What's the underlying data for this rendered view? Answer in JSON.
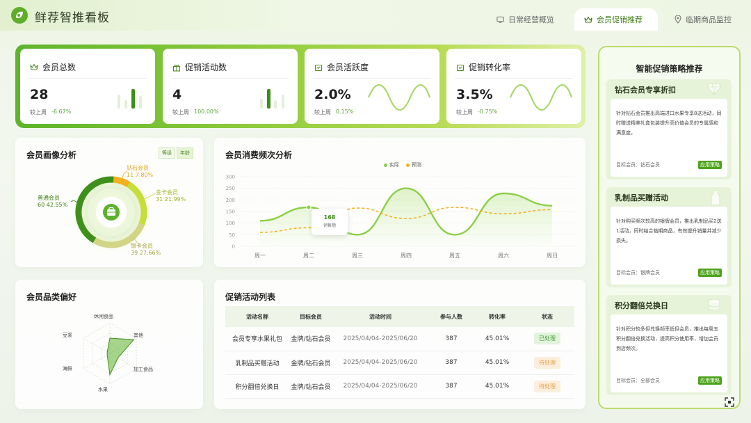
{
  "app": {
    "title": "鲜荐智推看板"
  },
  "tabs": [
    {
      "label": "日常经营概览",
      "active": false
    },
    {
      "label": "会员促销推荐",
      "active": true
    },
    {
      "label": "临期商品监控",
      "active": false
    }
  ],
  "kpis": [
    {
      "title": "会员总数",
      "value": "28",
      "compare_label": "较上周",
      "delta": "-6.67%",
      "icon": "crown-icon"
    },
    {
      "title": "促销活动数",
      "value": "4",
      "compare_label": "较上周",
      "delta": "100.00%",
      "icon": "gift-icon"
    },
    {
      "title": "会员活跃度",
      "value": "2.0%",
      "compare_label": "较上周",
      "delta": "0.15%",
      "icon": "activity-icon"
    },
    {
      "title": "促销转化率",
      "value": "3.5%",
      "compare_label": "较上周",
      "delta": "-0.75%",
      "icon": "conversion-icon"
    }
  ],
  "member_portrait": {
    "title": "会员画像分析",
    "toggle": [
      "等级",
      "年龄"
    ],
    "segments": [
      {
        "name": "钻石会员",
        "count": "11",
        "pct": "7.80%",
        "value": 7.8,
        "color": "#f2b01e"
      },
      {
        "name": "金卡会员",
        "count": "31",
        "pct": "21.99%",
        "value": 21.99,
        "color": "#c7dd3a"
      },
      {
        "name": "银卡会员",
        "count": "39",
        "pct": "27.66%",
        "value": 27.66,
        "color": "#d2d486"
      },
      {
        "name": "普通会员",
        "count": "60",
        "pct": "42.55%",
        "value": 42.55,
        "color": "#3f8f1c"
      }
    ]
  },
  "frequency_chart": {
    "title": "会员消费频次分析",
    "legend": [
      "实际",
      "预测"
    ],
    "tooltip": {
      "value": "168",
      "label": "销售额"
    },
    "chart_data": {
      "type": "line",
      "categories": [
        "周一",
        "周二",
        "周三",
        "周四",
        "周五",
        "周六",
        "周日"
      ],
      "yticks": [
        0,
        50,
        100,
        150,
        200,
        250,
        300
      ],
      "ylim": [
        0,
        300
      ],
      "series": [
        {
          "name": "实际",
          "values": [
            110,
            168,
            50,
            250,
            50,
            228,
            175
          ],
          "color": "#8ccf45"
        },
        {
          "name": "预测",
          "values": [
            60,
            80,
            165,
            120,
            168,
            140,
            158
          ],
          "color": "#f2b01e"
        }
      ]
    }
  },
  "category_pref": {
    "title": "会员品类偏好",
    "chart_data": {
      "type": "radar",
      "axes": [
        "休闲食品",
        "其他",
        "加工食品",
        "水果",
        "海鲜",
        "豆浆"
      ],
      "values": [
        0.5,
        0.9,
        0.3,
        0.7,
        0.1,
        0.1
      ]
    }
  },
  "activity_table": {
    "title": "促销活动列表",
    "columns": [
      "活动名称",
      "目标会员",
      "活动时间",
      "参与人数",
      "转化率",
      "状态"
    ],
    "rows": [
      {
        "name": "会员专享水果礼包",
        "target": "金牌/钻石会员",
        "time": "2025/04/04-2025/06/20",
        "participants": "387",
        "conversion": "45.01%",
        "status": "已处理",
        "status_type": "done"
      },
      {
        "name": "乳制品买赠活动",
        "target": "金牌/钻石会员",
        "time": "2025/04/04-2025/06/20",
        "participants": "387",
        "conversion": "45.01%",
        "status": "待处理",
        "status_type": "pending"
      },
      {
        "name": "积分翻倍兑换日",
        "target": "金牌/钻石会员",
        "time": "2025/04/04-2025/06/20",
        "participants": "387",
        "conversion": "45.01%",
        "status": "待处理",
        "status_type": "pending"
      }
    ]
  },
  "strategy": {
    "title": "智能促销策略推荐",
    "cards": [
      {
        "title": "钻石会员专享折扣",
        "desc": "针对钻石会员推出高端进口水果专享8这活动，同时赠送精美礼盒包装提升高价值会员的专属感和满意度。",
        "target": "目标会员：钻石会员",
        "button": "应用策略"
      },
      {
        "title": "乳制品买赠活动",
        "desc": "针对购买频次较高的银牌会员，推出乳制品买2送1活动，同时结合临期商品，有效提升销量并减少损失。",
        "target": "目标会员：银牌会员",
        "button": "应用策略"
      },
      {
        "title": "积分翻倍兑换日",
        "desc": "针对积分较多但兑换频率低但会员，推出每周五积分翻倍兑换活动，提高积分使用率，增加会员到店频次。",
        "target": "目标会员：全部会员",
        "button": "应用策略"
      }
    ]
  }
}
